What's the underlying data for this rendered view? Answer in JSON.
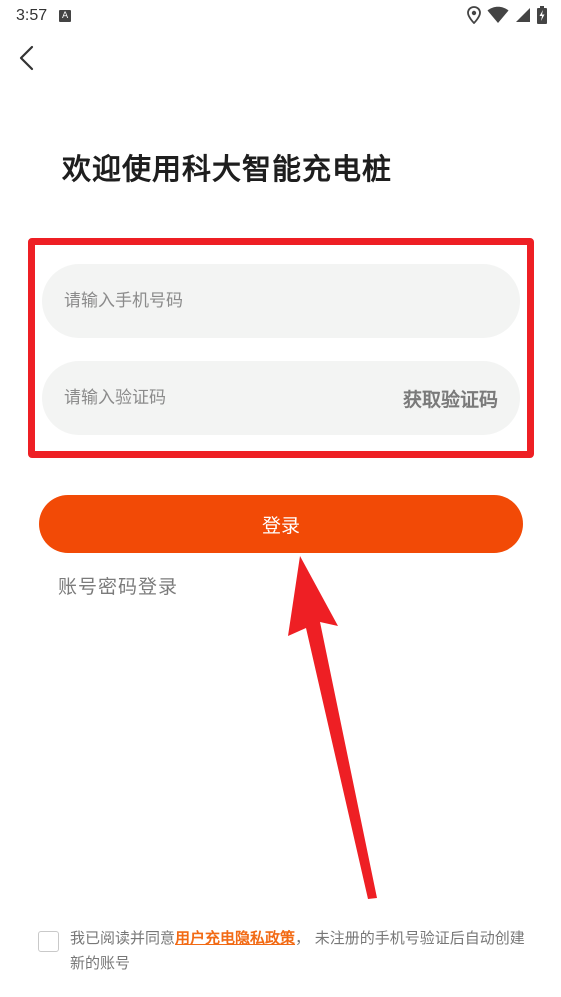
{
  "status_bar": {
    "time": "3:57",
    "badge": "A"
  },
  "header": {
    "welcome": "欢迎使用科大智能充电桩"
  },
  "form": {
    "phone_placeholder": "请输入手机号码",
    "code_placeholder": "请输入验证码",
    "get_code_label": "获取验证码",
    "login_label": "登录",
    "password_login_label": "账号密码登录"
  },
  "agreement": {
    "prefix": "我已阅读并同意",
    "policy_link": "用户充电隐私政策",
    "suffix": "， 未注册的手机号验证后自动创建新的账号"
  },
  "colors": {
    "accent": "#f24a06",
    "highlight": "#ee1f24",
    "link": "#f26a14"
  },
  "icons": {
    "back": "chevron-left-icon",
    "location": "location-icon",
    "wifi": "wifi-icon",
    "signal": "signal-icon",
    "battery": "battery-icon"
  }
}
